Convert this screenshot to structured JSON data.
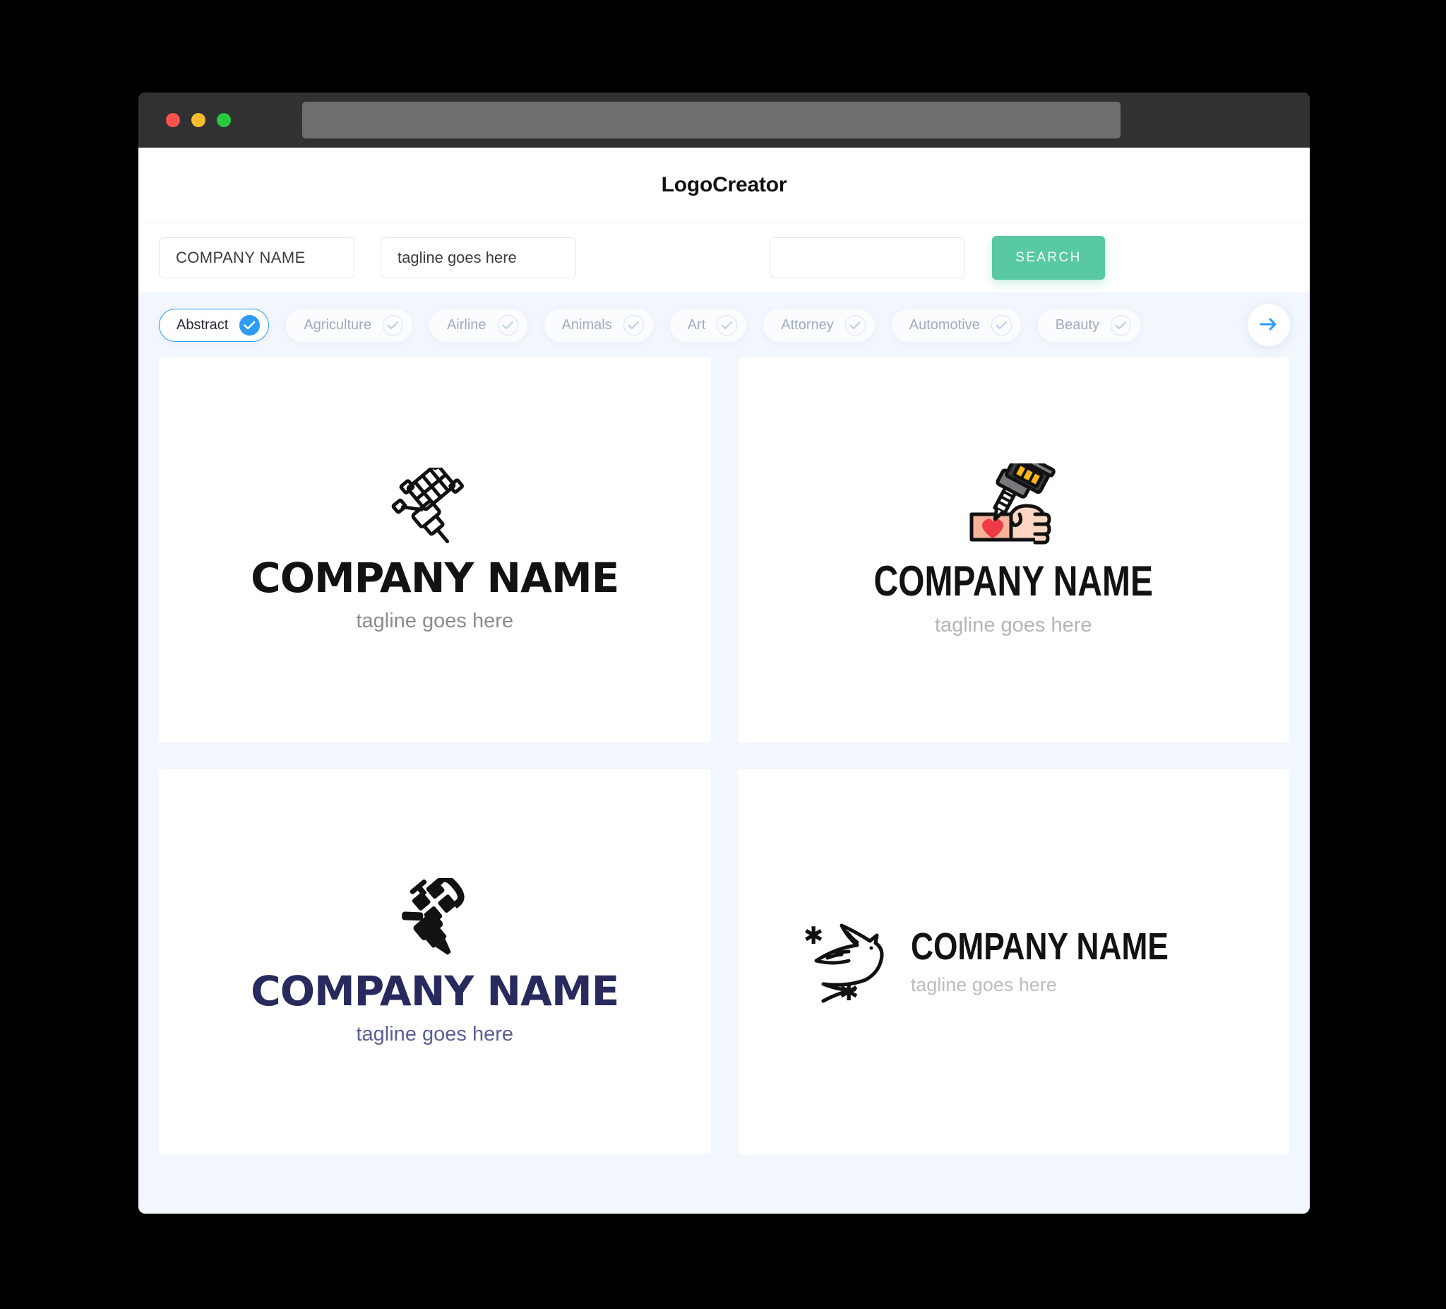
{
  "window": {
    "traffic_lights": [
      "close",
      "minimize",
      "maximize"
    ],
    "url_value": ""
  },
  "header": {
    "app_title": "LogoCreator"
  },
  "toolbar": {
    "company_value": "COMPANY NAME",
    "company_placeholder": "COMPANY NAME",
    "tagline_value": "tagline goes here",
    "tagline_placeholder": "tagline goes here",
    "keyword_value": "",
    "keyword_placeholder": "",
    "search_label": "SEARCH",
    "search_color": "#58c9a0"
  },
  "categories": {
    "accent_color": "#2e9bf5",
    "next_label": "→",
    "items": [
      {
        "label": "Abstract",
        "selected": true
      },
      {
        "label": "Agriculture",
        "selected": false
      },
      {
        "label": "Airline",
        "selected": false
      },
      {
        "label": "Animals",
        "selected": false
      },
      {
        "label": "Art",
        "selected": false
      },
      {
        "label": "Attorney",
        "selected": false
      },
      {
        "label": "Automotive",
        "selected": false
      },
      {
        "label": "Beauty",
        "selected": false
      }
    ]
  },
  "results": [
    {
      "icon": "tattoo-machine-outline-icon",
      "name": "COMPANY NAME",
      "tagline": "tagline goes here",
      "name_color": "#121212",
      "tagline_color": "#8b8b8b"
    },
    {
      "icon": "hand-tattoo-heart-color-icon",
      "name": "COMPANY NAME",
      "tagline": "tagline goes here",
      "name_color": "#121212",
      "tagline_color": "#b4b4b4"
    },
    {
      "icon": "tattoo-machine-solid-icon",
      "name": "COMPANY NAME",
      "tagline": "tagline goes here",
      "name_color": "#282a5e",
      "tagline_color": "#5b5f96"
    },
    {
      "icon": "swallow-bird-outline-icon",
      "name": "COMPANY NAME",
      "tagline": "tagline goes here",
      "name_color": "#121212",
      "tagline_color": "#bdbdbd"
    }
  ]
}
